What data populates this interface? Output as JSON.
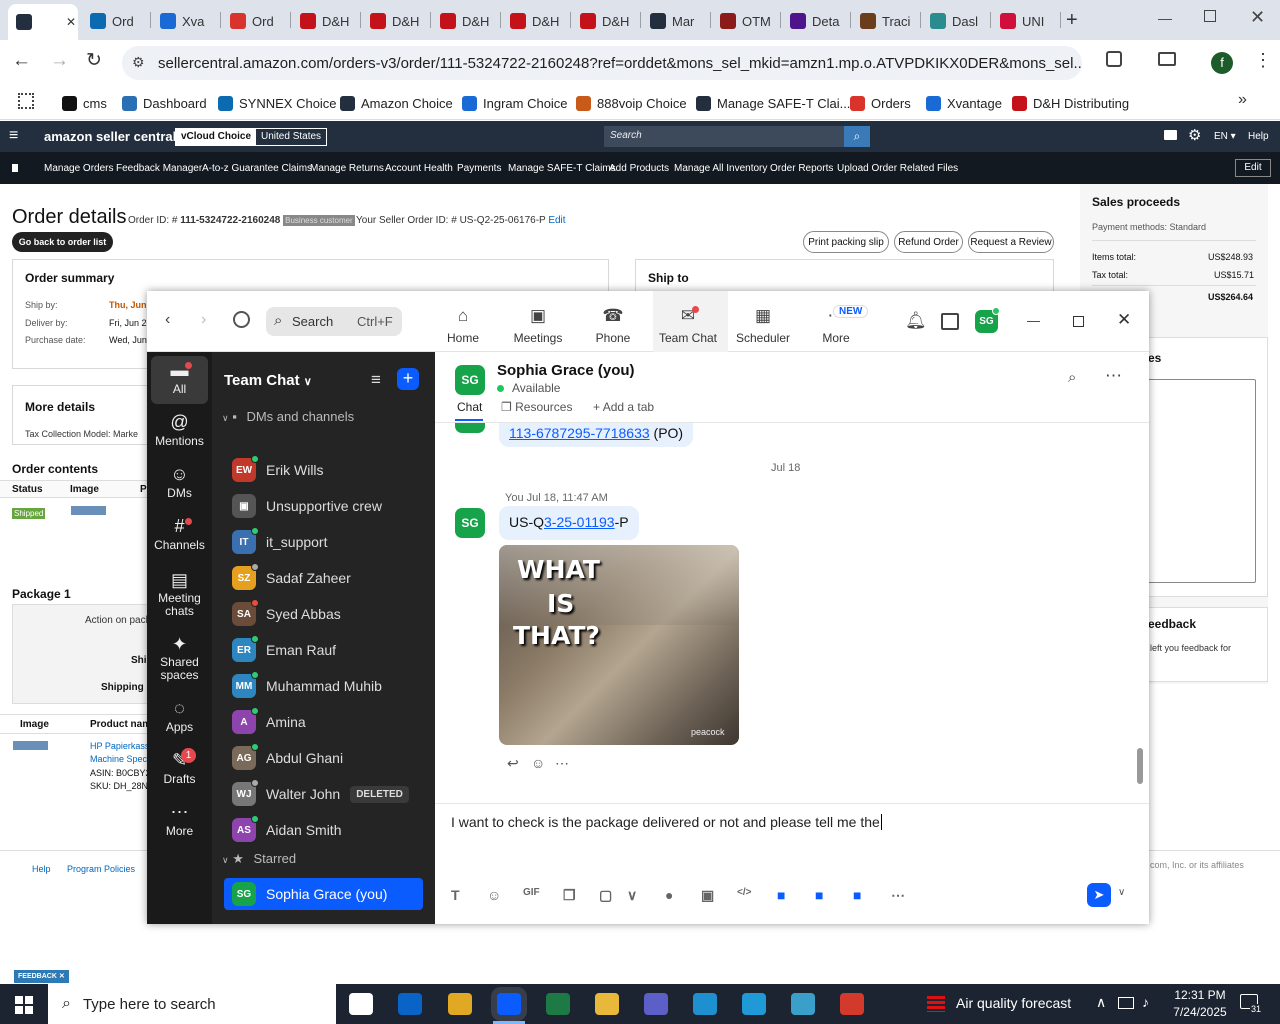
{
  "browser": {
    "tabs": [
      {
        "label": "",
        "icon": "amazon-icon",
        "color": "#232f3e"
      },
      {
        "label": "Ord",
        "icon": "synnex-icon",
        "color": "#0b6ab0"
      },
      {
        "label": "Xva",
        "icon": "xvantage-icon",
        "color": "#1a6ad6"
      },
      {
        "label": "Ord",
        "icon": "orders-icon",
        "color": "#d9342b"
      },
      {
        "label": "D&H",
        "icon": "dh-icon",
        "color": "#c4121b"
      },
      {
        "label": "D&H",
        "icon": "dh-icon",
        "color": "#c4121b"
      },
      {
        "label": "D&H",
        "icon": "dh-icon",
        "color": "#c4121b"
      },
      {
        "label": "D&H",
        "icon": "dh-icon",
        "color": "#c4121b"
      },
      {
        "label": "D&H",
        "icon": "dh-icon",
        "color": "#c4121b"
      },
      {
        "label": "Mar",
        "icon": "amazon-icon",
        "color": "#232f3e"
      },
      {
        "label": "OTM",
        "icon": "otm-icon",
        "color": "#8b1a1a"
      },
      {
        "label": "Deta",
        "icon": "fedex-icon",
        "color": "#4d148c"
      },
      {
        "label": "Traci",
        "icon": "ups-icon",
        "color": "#6b3d1b"
      },
      {
        "label": "Dasl",
        "icon": "dash-icon",
        "color": "#2a8c8c"
      },
      {
        "label": "UNI",
        "icon": "uline-icon",
        "color": "#d0103a"
      }
    ],
    "url": "sellercentral.amazon.com/orders-v3/order/111-5324722-2160248?ref=orddet&mons_sel_mkid=amzn1.mp.o.ATVPDKIKX0DER&mons_sel...",
    "bookmarks": [
      {
        "label": "cms",
        "color": "#111"
      },
      {
        "label": "Dashboard",
        "color": "#2a6fb3"
      },
      {
        "label": "SYNNEX Choice",
        "color": "#0b6ab0"
      },
      {
        "label": "Amazon Choice",
        "color": "#232f3e"
      },
      {
        "label": "Ingram Choice",
        "color": "#1a6ad6"
      },
      {
        "label": "888voip Choice",
        "color": "#c85a1a"
      },
      {
        "label": "Manage SAFE-T Clai...",
        "color": "#232f3e"
      },
      {
        "label": "Orders",
        "color": "#d9342b"
      },
      {
        "label": "Xvantage",
        "color": "#1a6ad6"
      },
      {
        "label": "D&H Distributing",
        "color": "#c4121b"
      }
    ],
    "profile_initial": "f"
  },
  "seller": {
    "logo": "amazon seller central",
    "account": "vCloud Choice",
    "region": "United States",
    "search_placeholder": "Search",
    "lang": "EN",
    "help": "Help",
    "nav": [
      "Manage Orders",
      "Feedback Manager",
      "A-to-z Guarantee Claims",
      "Manage Returns",
      "Account Health",
      "Payments",
      "Manage SAFE-T Claims",
      "Add Products",
      "Manage All Inventory",
      "Order Reports",
      "Upload Order Related Files"
    ],
    "edit": "Edit",
    "title": "Order details",
    "order_id_label": "Order ID: #",
    "order_id": "111-5324722-2160248",
    "business_badge": "Business customer",
    "seller_order_id": "Your Seller Order ID: # US-Q2-25-06176-P",
    "edit_link": "Edit",
    "back_button": "Go back to order list",
    "actions": [
      "Print packing slip",
      "Refund Order",
      "Request a Review"
    ],
    "order_summary": "Order summary",
    "ship_to": "Ship to",
    "ship_by_label": "Ship by:",
    "ship_by": "Thu, Jun",
    "deliver_by_label": "Deliver by:",
    "deliver_by": "Fri, Jun 2",
    "purchase_label": "Purchase date:",
    "purchase": "Wed, Jun",
    "more_details": "More details",
    "tax_model": "Tax Collection Model:  Marke",
    "order_contents": "Order contents",
    "status_col": "Status",
    "image_col": "Image",
    "pr_col": "Pi",
    "shipped": "Shipped",
    "package": "Package 1",
    "action_on_pack": "Action on pack",
    "shi": "Shi",
    "shipping_s": "Shipping s",
    "image_col2": "Image",
    "product_col": "Product nam",
    "product_name": "HP Papierkass",
    "product_line2": "Machine Spec",
    "asin": "ASIN: B0CBY2",
    "sku": "SKU: DH_28N",
    "sales_proceeds": "Sales proceeds",
    "payment_methods": "Payment methods: Standard",
    "items_total_label": "Items total:",
    "items_total": "US$248.93",
    "tax_total_label": "Tax total:",
    "tax_total": "US$15.71",
    "grand_total": "US$264.64",
    "notes_frag": "es",
    "feedback_title": "eedback",
    "feedback_text": "left you feedback for",
    "footer_help": "Help",
    "footer_policies": "Program Policies",
    "footer_copy": "com, Inc. or its affiliates",
    "feedback_tab": "FEEDBACK"
  },
  "zoom": {
    "search_label": "Search",
    "search_shortcut": "Ctrl+F",
    "nav": [
      {
        "label": "Home",
        "icon": "home-icon"
      },
      {
        "label": "Meetings",
        "icon": "video-icon"
      },
      {
        "label": "Phone",
        "icon": "phone-icon"
      },
      {
        "label": "Team Chat",
        "icon": "chat-icon"
      },
      {
        "label": "Scheduler",
        "icon": "calendar-icon"
      },
      {
        "label": "More",
        "icon": "more-icon"
      }
    ],
    "new_badge": "NEW",
    "user_initials": "SG",
    "rail": [
      {
        "label": "All",
        "icon": "chat-bubble-icon"
      },
      {
        "label": "Mentions",
        "icon": "at-icon"
      },
      {
        "label": "DMs",
        "icon": "people-icon"
      },
      {
        "label": "Channels",
        "icon": "hash-icon"
      },
      {
        "label": "Meeting chats",
        "icon": "meeting-chat-icon"
      },
      {
        "label": "Shared spaces",
        "icon": "shared-icon"
      },
      {
        "label": "Apps",
        "icon": "apps-icon"
      },
      {
        "label": "Drafts",
        "icon": "drafts-icon",
        "badge": "1"
      },
      {
        "label": "More",
        "icon": "ellipsis-icon"
      }
    ],
    "team_chat_title": "Team Chat",
    "section_dms": "DMs and channels",
    "contacts": [
      {
        "name": "Erik Wills",
        "initials": "EW",
        "color": "#c0392b",
        "status": "#2ecc71"
      },
      {
        "name": "Unsupportive crew",
        "initials": "",
        "color": "#555",
        "status": ""
      },
      {
        "name": "it_support",
        "initials": "IT",
        "color": "#3a6fb0",
        "status": "#2ecc71"
      },
      {
        "name": "Sadaf Zaheer",
        "initials": "SZ",
        "color": "#e6a020",
        "status": "#aaa"
      },
      {
        "name": "Syed Abbas",
        "initials": "SA",
        "color": "#6b4b3a",
        "status": "#e74c3c"
      },
      {
        "name": "Eman Rauf",
        "initials": "ER",
        "color": "#2e86c1",
        "status": "#2ecc71"
      },
      {
        "name": "Muhammad Muhib",
        "initials": "MM",
        "color": "#2e86c1",
        "status": "#2ecc71"
      },
      {
        "name": "Amina",
        "initials": "A",
        "color": "#8e44ad",
        "status": "#2ecc71"
      },
      {
        "name": "Abdul Ghani",
        "initials": "AG",
        "color": "#7a6a5a",
        "status": "#2ecc71"
      },
      {
        "name": "Walter John",
        "initials": "WJ",
        "color": "#777",
        "status": "#aaa",
        "badge": "DELETED"
      },
      {
        "name": "Aidan Smith",
        "initials": "AS",
        "color": "#8e44ad",
        "status": "#2ecc71"
      }
    ],
    "section_starred": "Starred",
    "starred_contact": {
      "name": "Sophia Grace (you)",
      "initials": "SG"
    },
    "chat_name": "Sophia Grace (you)",
    "chat_status": "Available",
    "chat_tabs": [
      "Chat",
      "Resources",
      "Add a tab"
    ],
    "prev_message_link": "113-6787295-7718633",
    "prev_message_suffix": " (PO)",
    "date_divider": "Jul 18",
    "msg_meta": "You Jul 18, 11:47 AM",
    "msg_prefix": "US-Q",
    "msg_link": "3-25-01193",
    "msg_suffix": "-P",
    "gif_text": [
      "WHAT",
      "IS",
      "THAT?"
    ],
    "gif_watermark": "peacock",
    "composer_text": "I want to check is the package delivered or not and please tell me the"
  },
  "taskbar": {
    "search_placeholder": "Type here to search",
    "weather": "Air quality forecast",
    "time": "12:31 PM",
    "date": "7/24/2025",
    "notif_count": "31"
  }
}
